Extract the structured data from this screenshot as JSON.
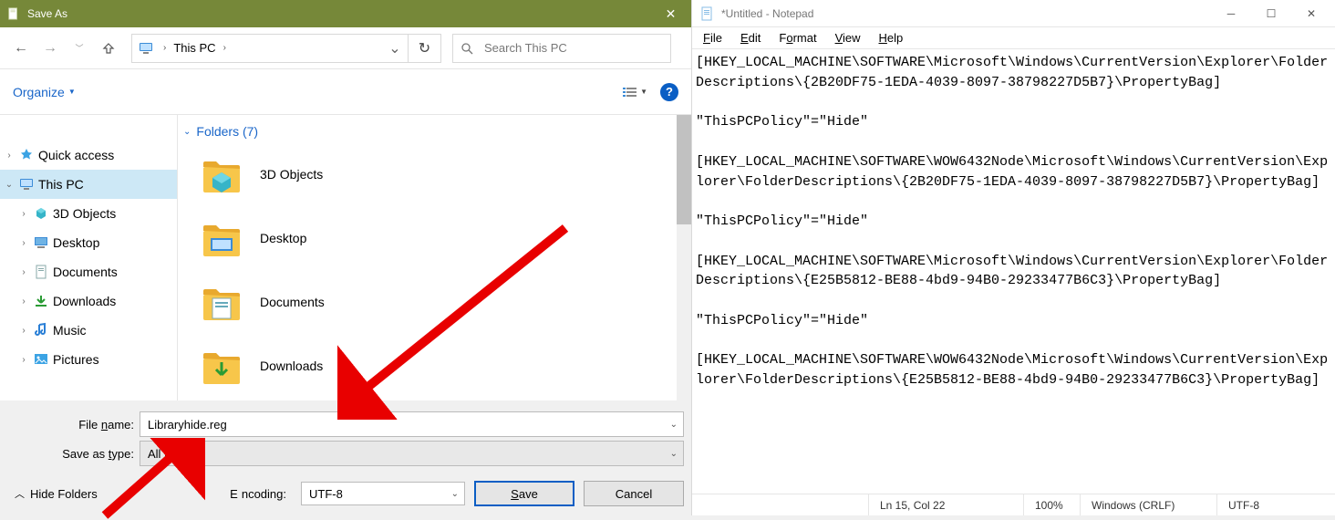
{
  "save_dialog": {
    "title": "Save As",
    "location_label": "This PC",
    "search_placeholder": "Search This PC",
    "organize_label": "Organize",
    "group_header": "Folders (7)",
    "tree": [
      {
        "label": "Quick access",
        "icon": "star",
        "caret": "right",
        "indent": 0
      },
      {
        "label": "This PC",
        "icon": "pc",
        "caret": "down",
        "indent": 0,
        "selected": true
      },
      {
        "label": "3D Objects",
        "icon": "3d",
        "caret": "right",
        "indent": 1
      },
      {
        "label": "Desktop",
        "icon": "desktop",
        "caret": "right",
        "indent": 1
      },
      {
        "label": "Documents",
        "icon": "docs",
        "caret": "right",
        "indent": 1
      },
      {
        "label": "Downloads",
        "icon": "down",
        "caret": "right",
        "indent": 1
      },
      {
        "label": "Music",
        "icon": "music",
        "caret": "right",
        "indent": 1
      },
      {
        "label": "Pictures",
        "icon": "pics",
        "caret": "right",
        "indent": 1
      }
    ],
    "folders": [
      "3D Objects",
      "Desktop",
      "Documents",
      "Downloads"
    ],
    "filename_label": "File name:",
    "filename_value": "Libraryhide.reg",
    "type_label": "Save as type:",
    "type_value": "All Files",
    "encoding_label": "Encoding:",
    "encoding_value": "UTF-8",
    "save_label": "Save",
    "cancel_label": "Cancel",
    "hide_folders_label": "Hide Folders"
  },
  "notepad": {
    "title": "*Untitled - Notepad",
    "menu": [
      "File",
      "Edit",
      "Format",
      "View",
      "Help"
    ],
    "content": "[HKEY_LOCAL_MACHINE\\SOFTWARE\\Microsoft\\Windows\\CurrentVersion\\Explorer\\FolderDescriptions\\{2B20DF75-1EDA-4039-8097-38798227D5B7}\\PropertyBag]\n\n\"ThisPCPolicy\"=\"Hide\"\n\n[HKEY_LOCAL_MACHINE\\SOFTWARE\\WOW6432Node\\Microsoft\\Windows\\CurrentVersion\\Explorer\\FolderDescriptions\\{2B20DF75-1EDA-4039-8097-38798227D5B7}\\PropertyBag]\n\n\"ThisPCPolicy\"=\"Hide\"\n\n[HKEY_LOCAL_MACHINE\\SOFTWARE\\Microsoft\\Windows\\CurrentVersion\\Explorer\\FolderDescriptions\\{E25B5812-BE88-4bd9-94B0-29233477B6C3}\\PropertyBag]\n\n\"ThisPCPolicy\"=\"Hide\"\n\n[HKEY_LOCAL_MACHINE\\SOFTWARE\\WOW6432Node\\Microsoft\\Windows\\CurrentVersion\\Explorer\\FolderDescriptions\\{E25B5812-BE88-4bd9-94B0-29233477B6C3}\\PropertyBag]",
    "status": {
      "pos": "Ln 15, Col 22",
      "zoom": "100%",
      "eol": "Windows (CRLF)",
      "enc": "UTF-8"
    }
  }
}
